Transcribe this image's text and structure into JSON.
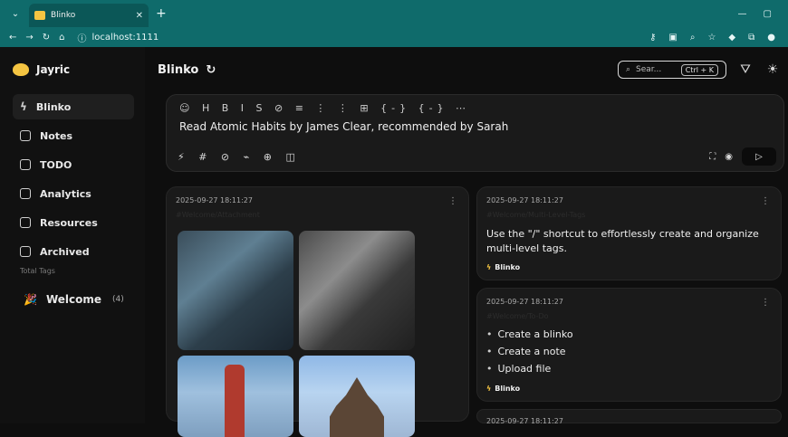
{
  "browser": {
    "tab_title": "Blinko",
    "url": "localhost:1111",
    "new_tab": "+",
    "window_controls": [
      "—",
      "▢"
    ],
    "nav_icons": [
      "←",
      "→",
      "↻",
      "⌂"
    ]
  },
  "sidebar": {
    "brand": "Jayric",
    "items": [
      {
        "label": "Blinko",
        "icon": "bolt-icon",
        "active": true
      },
      {
        "label": "Notes",
        "icon": "note-icon",
        "active": false
      },
      {
        "label": "TODO",
        "icon": "checkbox-icon",
        "active": false
      },
      {
        "label": "Analytics",
        "icon": "analytics-icon",
        "active": false
      },
      {
        "label": "Resources",
        "icon": "database-icon",
        "active": false
      },
      {
        "label": "Archived",
        "icon": "box-icon",
        "active": false
      }
    ],
    "tags_title": "Total Tags",
    "tag": {
      "label": "Welcome",
      "count": "(4)"
    }
  },
  "header": {
    "title": "Blinko",
    "search_placeholder": "Sear...",
    "shortcut": "Ctrl + K"
  },
  "editor": {
    "text": "Read Atomic Habits by James Clear, recommended by Sarah",
    "toolbar": "☺ H B I S ⊘ ≡ ⋮ ⋮ ⊞ {-} {-} ⋯",
    "bottom_tools": "⚡ # ⊘ ⌁ ⊕ ◫"
  },
  "cards": [
    {
      "time": "2025-09-27 18:11:27",
      "subtitle": "#Welcome/Attachment",
      "tag": ""
    },
    {
      "time": "2025-09-27 18:11:27",
      "subtitle": "#Welcome/Multi-Level-Tags",
      "text": "Use the \"/\" shortcut to effortlessly create and organize multi-level tags.",
      "tag": "Blinko"
    },
    {
      "time": "2025-09-27 18:11:27",
      "subtitle": "#Welcome/To-Do",
      "list": [
        "Create a blinko",
        "Create a note",
        "Upload file"
      ],
      "tag": "Blinko"
    },
    {
      "time": "2025-09-27 18:11:27"
    }
  ]
}
